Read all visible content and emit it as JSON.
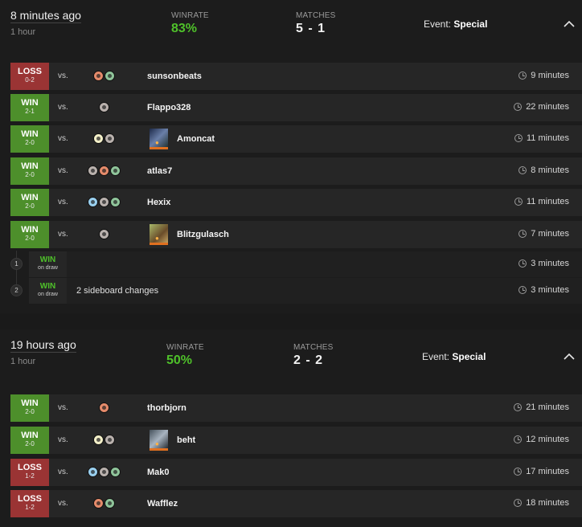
{
  "sessions": [
    {
      "time": "8 minutes ago",
      "duration": "1 hour",
      "winrate_label": "WINRATE",
      "winrate": "83%",
      "matches_label": "MATCHES",
      "matches": "5 - 1",
      "event_label": "Event:",
      "event": "Special",
      "collapse_icon": "chevron-up-icon",
      "rows": [
        {
          "result": "LOSS",
          "score": "0-2",
          "vs": "vs.",
          "opponent": "sunsonbeats",
          "duration": "9 minutes",
          "mana": [
            "R",
            "G"
          ]
        },
        {
          "result": "WIN",
          "score": "2-1",
          "vs": "vs.",
          "opponent": "Flappo328",
          "duration": "22 minutes",
          "mana": [
            "B"
          ]
        },
        {
          "result": "WIN",
          "score": "2-0",
          "vs": "vs.",
          "opponent": "Amoncat",
          "duration": "11 minutes",
          "mana": [
            "W",
            "B"
          ]
        },
        {
          "result": "WIN",
          "score": "2-0",
          "vs": "vs.",
          "opponent": "atlas7",
          "duration": "8 minutes",
          "mana": [
            "B",
            "R",
            "G"
          ]
        },
        {
          "result": "WIN",
          "score": "2-0",
          "vs": "vs.",
          "opponent": "Hexix",
          "duration": "11 minutes",
          "mana": [
            "U",
            "B",
            "G"
          ]
        },
        {
          "result": "WIN",
          "score": "2-0",
          "vs": "vs.",
          "opponent": "Blitzgulasch",
          "duration": "7 minutes",
          "mana": [
            "B"
          ]
        }
      ],
      "games": [
        {
          "num": "1",
          "result": "WIN",
          "sub": "on draw",
          "note": "",
          "duration": "3 minutes"
        },
        {
          "num": "2",
          "result": "WIN",
          "sub": "on draw",
          "note": "2 sideboard changes",
          "duration": "3 minutes"
        }
      ]
    },
    {
      "time": "19 hours ago",
      "duration": "1 hour",
      "winrate_label": "WINRATE",
      "winrate": "50%",
      "matches_label": "MATCHES",
      "matches": "2 - 2",
      "event_label": "Event:",
      "event": "Special",
      "collapse_icon": "chevron-up-icon",
      "rows": [
        {
          "result": "WIN",
          "score": "2-0",
          "vs": "vs.",
          "opponent": "thorbjorn",
          "duration": "21 minutes",
          "mana": [
            "R"
          ]
        },
        {
          "result": "WIN",
          "score": "2-0",
          "vs": "vs.",
          "opponent": "beht",
          "duration": "12 minutes",
          "mana": [
            "W",
            "B"
          ]
        },
        {
          "result": "LOSS",
          "score": "1-2",
          "vs": "vs.",
          "opponent": "Mak0",
          "duration": "17 minutes",
          "mana": [
            "U",
            "B",
            "G"
          ]
        },
        {
          "result": "LOSS",
          "score": "1-2",
          "vs": "vs.",
          "opponent": "Wafflez",
          "duration": "18 minutes",
          "mana": [
            "R",
            "G"
          ]
        }
      ]
    }
  ]
}
